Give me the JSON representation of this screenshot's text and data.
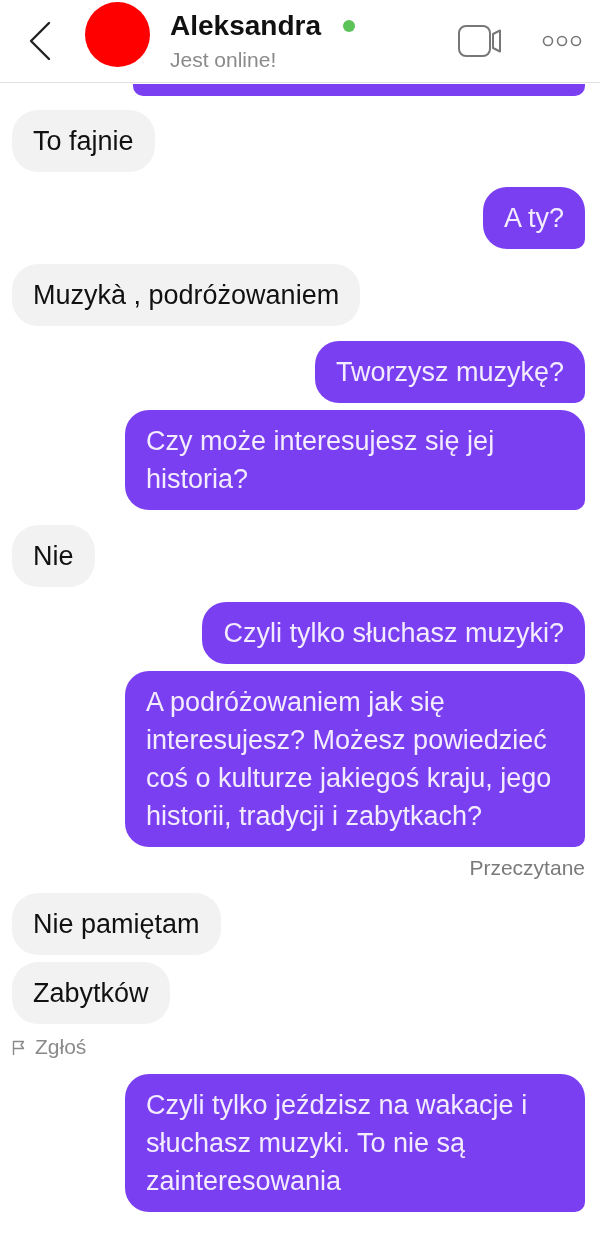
{
  "header": {
    "contact_name": "Aleksandra",
    "online": true,
    "status_text": "Jest online!"
  },
  "chat": [
    {
      "kind": "sent-edge"
    },
    {
      "kind": "received",
      "text": "To fajnie"
    },
    {
      "kind": "sent",
      "text": "A ty?"
    },
    {
      "kind": "received",
      "text": "Muzykà , podróżowaniem"
    },
    {
      "kind": "sent",
      "text": "Tworzysz muzykę?"
    },
    {
      "kind": "sent",
      "text": "Czy może interesujesz się jej historia?"
    },
    {
      "kind": "received",
      "text": "Nie"
    },
    {
      "kind": "sent",
      "text": "Czyli tylko słuchasz muzyki?"
    },
    {
      "kind": "sent",
      "text": "A podróżowaniem jak się interesujesz? Możesz powiedzieć coś o kulturze jakiegoś kraju, jego historii, tradycji i zabytkach?"
    },
    {
      "kind": "receipt",
      "text": "Przeczytane"
    },
    {
      "kind": "received",
      "text": "Nie pamiętam"
    },
    {
      "kind": "received",
      "text": "Zabytków"
    },
    {
      "kind": "report",
      "text": "Zgłoś"
    },
    {
      "kind": "sent",
      "text": "Czyli tylko jeździsz na wakacje i słuchasz muzyki. To nie są zainteresowania"
    }
  ]
}
